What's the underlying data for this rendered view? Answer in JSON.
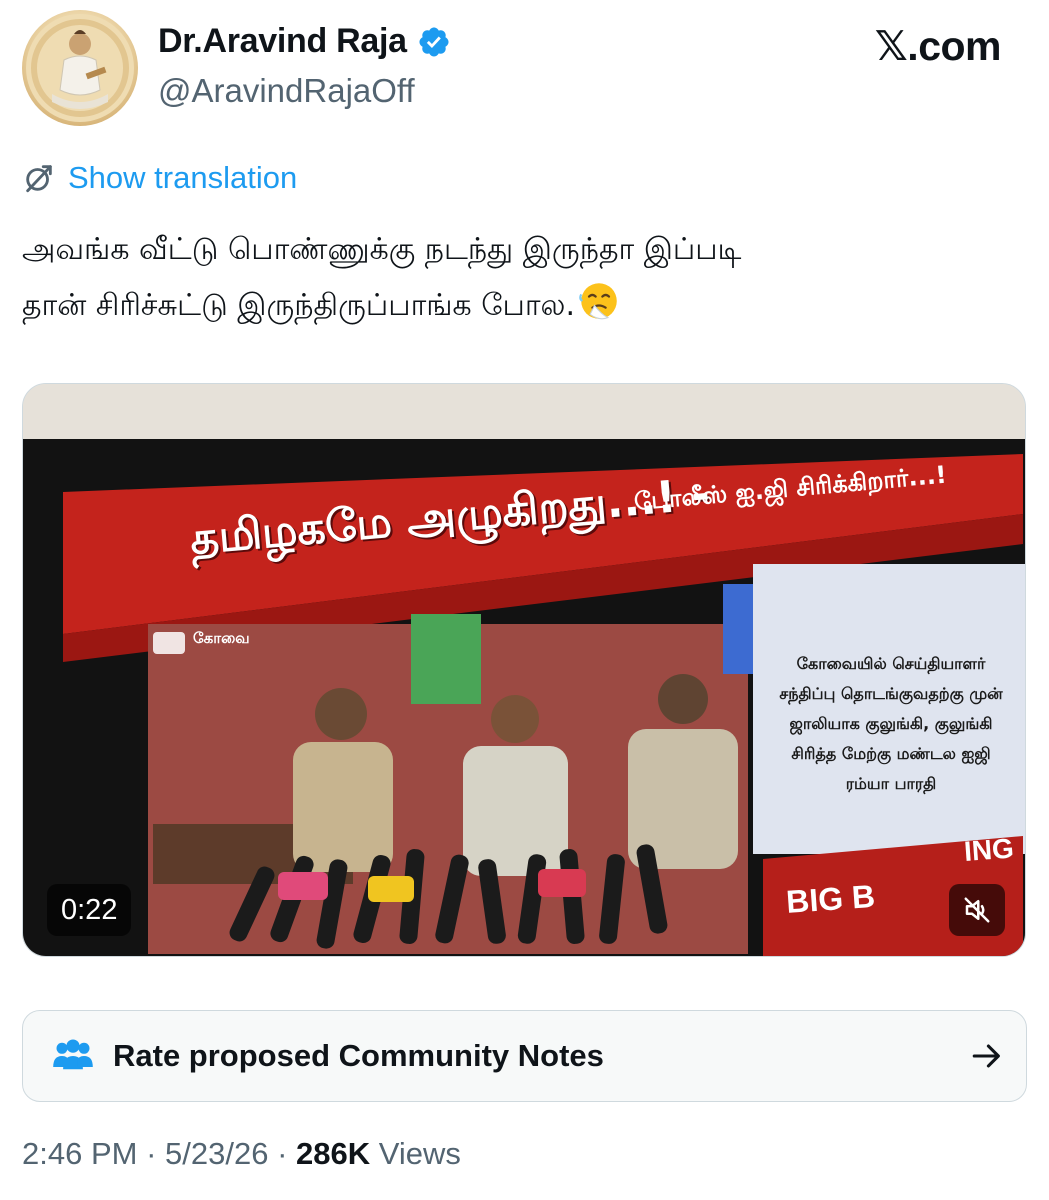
{
  "author": {
    "display_name": "Dr.Aravind Raja",
    "handle": "@AravindRajaOff",
    "verified": true
  },
  "brand": "𝕏.com",
  "translation": {
    "label": "Show translation"
  },
  "tweet": {
    "line1": "அவங்க வீட்டு பொண்ணுக்கு நடந்து இருந்தா இப்படி",
    "line2": "தான் சிரிச்சுட்டு இருந்திருப்பாங்க போல."
  },
  "video": {
    "duration": "0:22",
    "headline": "தமிழகமே அழுகிறது...! -",
    "headline_tail": "போலீஸ் ஐ.ஜி சிரிக்கிறார்...!",
    "city": "கோவை",
    "side_text": "கோவையில் செய்தியாளர்\nசந்திப்பு தொடங்குவதற்கு முன்\nஜாலியாக குலுங்கி, குலுங்கி\nசிரித்த மேற்கு மண்டல ஐஜி\nரம்யா பாரதி",
    "big_label": "BIG B",
    "ing_label": "ING"
  },
  "community_notes": {
    "label": "Rate proposed Community Notes"
  },
  "meta": {
    "time": "2:46 PM",
    "separator": "·",
    "date": "5/23/26",
    "views_count": "286K",
    "views_label": "Views"
  },
  "colors": {
    "link": "#1d9bf0",
    "verified": "#1d9bf0",
    "secondary": "#536471"
  },
  "icons": [
    "verified-badge-icon",
    "translate-icon",
    "mute-icon",
    "community-notes-icon",
    "arrow-right-icon",
    "sneezing-face-emoji"
  ]
}
